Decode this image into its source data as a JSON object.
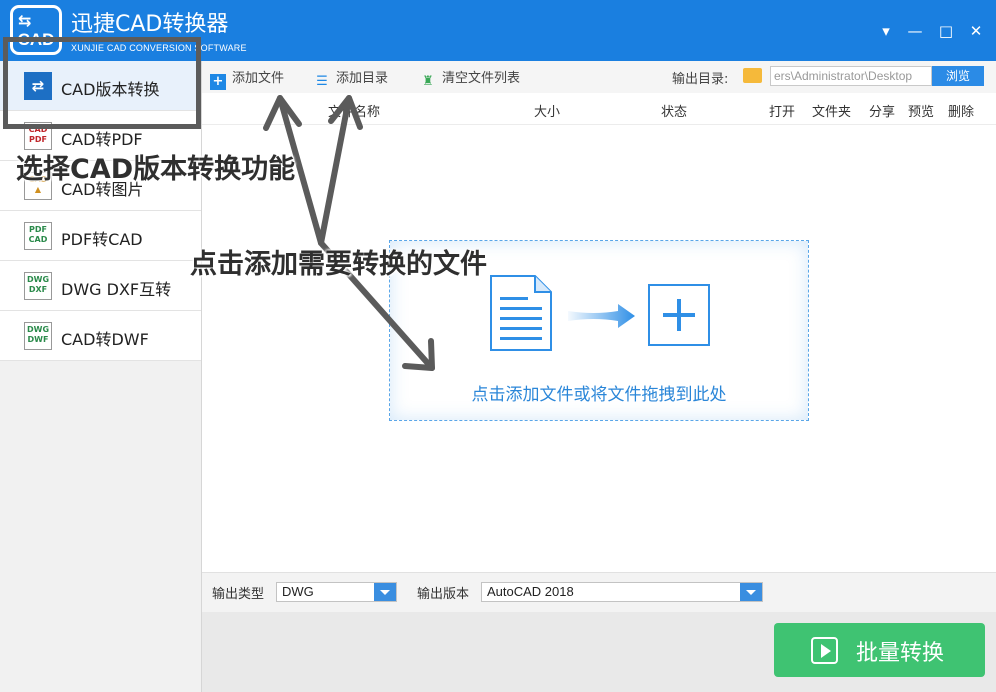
{
  "app": {
    "title": "迅捷CAD转换器",
    "subtitle": "XUNJIE CAD CONVERSION SOFTWARE",
    "logo_text": "CAD"
  },
  "window_controls": {
    "menu": "▾",
    "minimize": "—",
    "maximize": "□",
    "close": "✕"
  },
  "sidebar": {
    "items": [
      {
        "label": "CAD版本转换",
        "icon": "cad-version-convert-icon",
        "active": true
      },
      {
        "label": "CAD转PDF",
        "icon": "cad-to-pdf-icon"
      },
      {
        "label": "CAD转图片",
        "icon": "cad-to-image-icon"
      },
      {
        "label": "PDF转CAD",
        "icon": "pdf-to-cad-icon"
      },
      {
        "label": "DWG DXF互转",
        "icon": "dwg-dxf-convert-icon"
      },
      {
        "label": "CAD转DWF",
        "icon": "cad-to-dwf-icon"
      }
    ]
  },
  "toolbar": {
    "add_file": "添加文件",
    "add_folder": "添加目录",
    "clear_list": "清空文件列表",
    "output_dir_label": "输出目录:",
    "output_dir_value": "ers\\Administrator\\Desktop",
    "browse": "浏览"
  },
  "table": {
    "columns": [
      "文件名称",
      "大小",
      "状态",
      "打开",
      "文件夹",
      "分享",
      "预览",
      "删除"
    ]
  },
  "dropzone": {
    "text": "点击添加文件或将文件拖拽到此处"
  },
  "options": {
    "output_type_label": "输出类型",
    "output_type_value": "DWG",
    "output_version_label": "输出版本",
    "output_version_value": "AutoCAD 2018"
  },
  "convert_button": "批量转换",
  "annotations": {
    "select_function": "选择CAD版本转换功能",
    "add_files": "点击添加需要转换的文件"
  },
  "colors": {
    "titlebar": "#1a7fe0",
    "accent": "#2b8be6",
    "convert": "#3fc372",
    "annotation": "#5b5b5b"
  }
}
